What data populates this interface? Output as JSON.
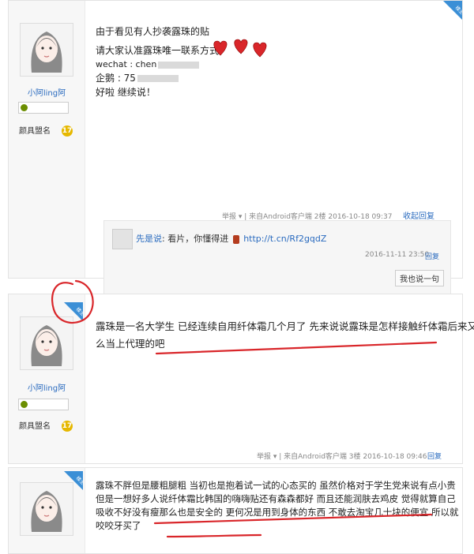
{
  "post1": {
    "username": "小阿ling阿",
    "medal_label": "颜具盟名",
    "corner_tag": "楼主",
    "lines": [
      "由于看见有人抄袭露珠的贴",
      "请大家认准露珠唯一联系方式",
      "wechat : chen",
      "企鹅 : 75",
      "好啦 继续说！"
    ],
    "meta": "举报 ▾ | 来自Android客户端 2楼 2016-10-18 09:37",
    "reply_button": "收起回复",
    "reply": {
      "user": "先是说",
      "text": "看片，你懂得进",
      "link": "http://t.cn/Rf2gqdZ",
      "time": "2016-11-11 23:50",
      "action": "回复"
    },
    "say_button": "我也说一句"
  },
  "post2": {
    "username": "小阿ling阿",
    "medal_label": "颜具盟名",
    "corner_tag": "楼主",
    "text_lines": [
      "露珠是一名大学生 已经连续自用纤体霜几个月了 先来说说露珠是怎样接触纤体霜后来又是怎",
      "么当上代理的吧"
    ],
    "meta": "举报 ▾ | 来自Android客户端 3楼 2016-10-18 09:46",
    "reply_button": "回复"
  },
  "post3": {
    "corner_tag": "楼主",
    "text_lines": [
      "露珠不胖但是腰粗腿粗 当初也是抱着试一试的心态买的 虽然价格对于学生党来说有点小贵",
      "但是一想好多人说纤体霜比韩国的嗨嗨贴还有森森都好 而且还能润肤去鸡皮 觉得就算自己",
      "吸收不好没有瘦那么也是安全的 更何况是用到身体的东西 不敢去淘宝几十块的便宜 所以就",
      "咬咬牙买了"
    ]
  },
  "colors": {
    "link": "#2a6bbf",
    "annotation_red": "#d9262a",
    "corner_blue": "#3b8fd6"
  }
}
